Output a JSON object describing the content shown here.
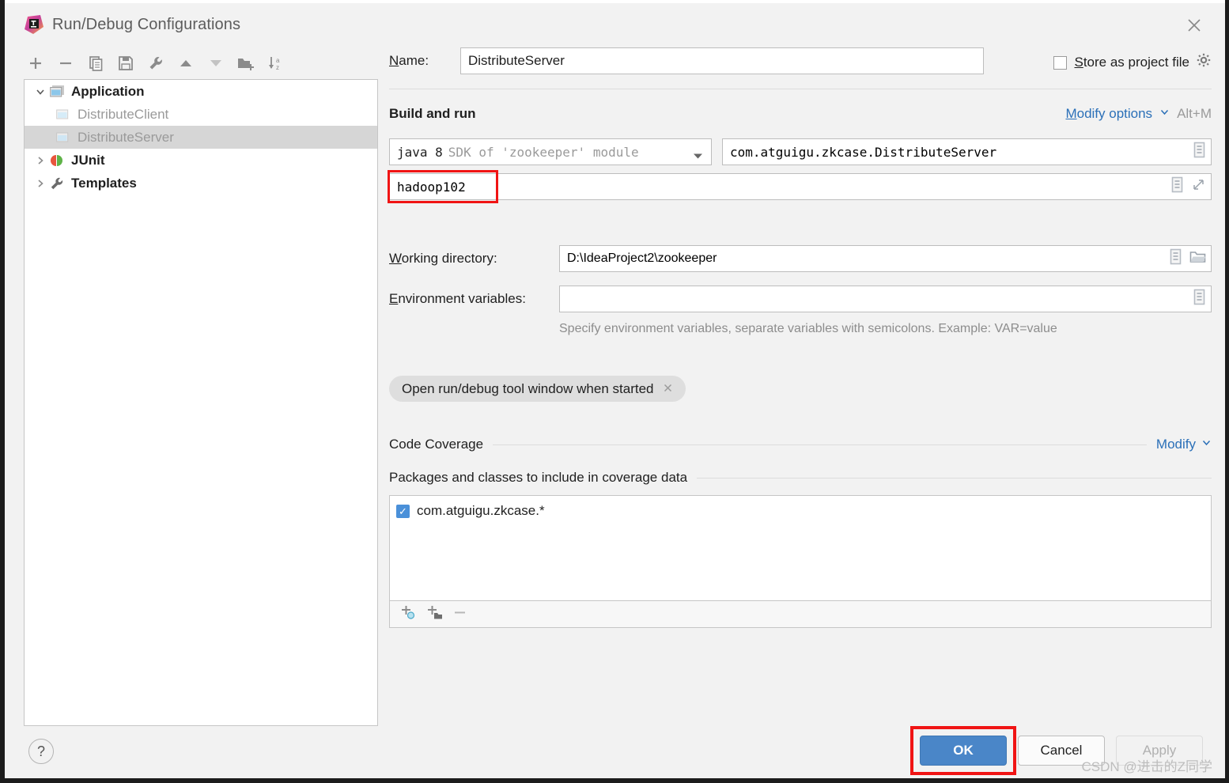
{
  "window": {
    "title": "Run/Debug Configurations",
    "logo_icon": "intellij-idea-logo",
    "close_icon": "close-icon"
  },
  "toolbar": {
    "items": [
      {
        "name": "add-configuration-button",
        "icon": "plus-icon",
        "glyph": "+"
      },
      {
        "name": "remove-configuration-button",
        "icon": "minus-icon",
        "glyph": "−"
      },
      {
        "name": "copy-configuration-button",
        "icon": "copy-icon",
        "glyph": "copy"
      },
      {
        "name": "save-configuration-button",
        "icon": "save-icon",
        "glyph": "save"
      },
      {
        "name": "edit-templates-button",
        "icon": "wrench-icon",
        "glyph": "wrench"
      },
      {
        "name": "move-up-button",
        "icon": "arrow-up-icon",
        "glyph": "▲"
      },
      {
        "name": "move-down-button",
        "icon": "arrow-down-icon",
        "glyph": "▼"
      },
      {
        "name": "move-into-folder-button",
        "icon": "new-folder-icon",
        "glyph": "folder"
      },
      {
        "name": "sort-configurations-button",
        "icon": "sort-alphabetically-icon",
        "glyph": "sort"
      }
    ]
  },
  "tree": {
    "items": [
      {
        "label": "Application",
        "level": 0,
        "expanded": true,
        "bold": true,
        "icon": "application-icon",
        "selected": false
      },
      {
        "label": "DistributeClient",
        "level": 1,
        "expanded": null,
        "bold": false,
        "icon": "application-icon",
        "selected": false
      },
      {
        "label": "DistributeServer",
        "level": 1,
        "expanded": null,
        "bold": false,
        "icon": "application-icon",
        "selected": true
      },
      {
        "label": "JUnit",
        "level": 0,
        "expanded": false,
        "bold": true,
        "icon": "junit-icon",
        "selected": false
      },
      {
        "label": "Templates",
        "level": 0,
        "expanded": false,
        "bold": true,
        "icon": "wrench-icon",
        "selected": false
      }
    ]
  },
  "form": {
    "name_label": "Name:",
    "name_label_mnemonic": "N",
    "name_value": "DistributeServer",
    "store_as_project_file": {
      "label": "Store as project file",
      "mnemonic": "S",
      "checked": false,
      "gear_icon": "gear-icon"
    },
    "build_and_run": {
      "title": "Build and run",
      "modify_options_link": "Modify options",
      "modify_options_mnemonic": "M",
      "shortcut": "Alt+M",
      "chevron_icon": "chevron-down-icon"
    },
    "sdk": {
      "value_prefix": "java 8",
      "value_suffix": "SDK of 'zookeeper' module",
      "dropdown_icon": "chevron-down-icon"
    },
    "main_class": {
      "value": "com.atguigu.zkcase.DistributeServer",
      "browse_icon": "list-icon"
    },
    "program_arguments": {
      "value": "hadoop102",
      "macro_icon": "list-icon",
      "expand_icon": "expand-diagonal-icon",
      "highlighted": true
    },
    "working_directory": {
      "label": "Working directory:",
      "mnemonic": "W",
      "value": "D:\\IdeaProject2\\zookeeper",
      "macro_icon": "list-icon",
      "browse_icon": "folder-icon"
    },
    "environment_variables": {
      "label": "Environment variables:",
      "mnemonic": "E",
      "value": "",
      "placeholder": "",
      "macro_icon": "list-icon",
      "hint": "Specify environment variables, separate variables with semicolons. Example: VAR=value"
    },
    "option_chip": {
      "label": "Open run/debug tool window when started",
      "remove_icon": "close-small-icon"
    }
  },
  "code_coverage": {
    "title": "Code Coverage",
    "modify_link": "Modify",
    "chevron_icon": "chevron-down-icon",
    "sub_title": "Packages and classes to include in coverage data",
    "items": [
      {
        "label": "com.atguigu.zkcase.*",
        "checked": true
      }
    ],
    "toolbar": [
      {
        "name": "add-class-button",
        "icon": "add-class-icon"
      },
      {
        "name": "add-package-button",
        "icon": "add-package-icon"
      },
      {
        "name": "remove-pattern-button",
        "icon": "minus-icon"
      }
    ]
  },
  "footer": {
    "help_label": "?",
    "ok_label": "OK",
    "cancel_label": "Cancel",
    "apply_label": "Apply",
    "ok_highlighted": true,
    "apply_disabled": true,
    "watermark": "CSDN @进击的Z同学"
  },
  "colors": {
    "accent_blue": "#4a86c8",
    "link_blue": "#2b70b8",
    "highlight_red": "#f01414",
    "checkbox_blue": "#4a90d9",
    "selection_gray": "#d6d6d6",
    "dialog_bg": "#f2f2f2"
  }
}
